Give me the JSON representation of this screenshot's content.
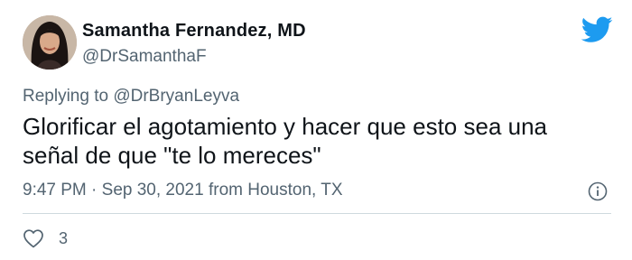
{
  "author": {
    "name": "Samantha Fernandez, MD",
    "handle": "@DrSamanthaF"
  },
  "reply": {
    "prefix": "Replying to",
    "mention": "@DrBryanLeyva"
  },
  "tweet": {
    "text": "Glorificar el agotamiento y hacer que esto sea una señal de que \"te lo mereces\"",
    "meta": "9:47 PM · Sep 30, 2021 from Houston, TX"
  },
  "engagement": {
    "likes": "3"
  },
  "icons": {
    "brand": "twitter-bird-icon",
    "info": "info-icon",
    "like": "heart-icon"
  },
  "colors": {
    "brand": "#1d9bf0",
    "secondary_text": "#536471",
    "primary_text": "#0f1419",
    "divider": "#cfd9de"
  }
}
